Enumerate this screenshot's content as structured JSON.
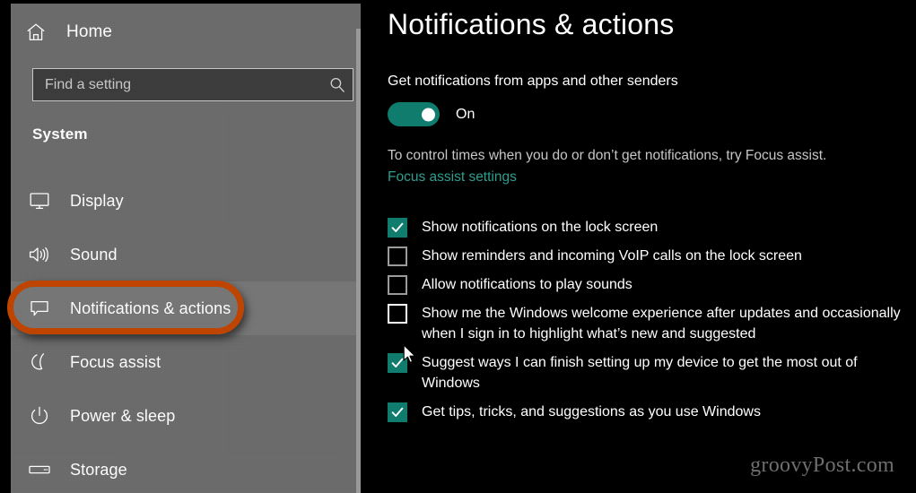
{
  "colors": {
    "sidebar_bg": "#6a6a6a",
    "sidebar_selected_bg": "#757575",
    "main_bg": "#000000",
    "accent_teal": "#107c6d",
    "link_teal": "#2e9e8f",
    "annotation_orange": "#bf4400",
    "search_bg": "#3b3b3b",
    "search_border": "#c8c8c8",
    "watermark": "#6e6e6e"
  },
  "sidebar": {
    "home": {
      "label": "Home",
      "icon": "home-icon"
    },
    "search": {
      "placeholder": "Find a setting",
      "value": "",
      "icon": "search-icon"
    },
    "section_title": "System",
    "items": [
      {
        "label": "Display",
        "icon": "monitor-icon",
        "selected": false
      },
      {
        "label": "Sound",
        "icon": "speaker-icon",
        "selected": false
      },
      {
        "label": "Notifications & actions",
        "icon": "speech-bubble-icon",
        "selected": true
      },
      {
        "label": "Focus assist",
        "icon": "moon-icon",
        "selected": false
      },
      {
        "label": "Power & sleep",
        "icon": "power-icon",
        "selected": false
      },
      {
        "label": "Storage",
        "icon": "drive-icon",
        "selected": false
      }
    ]
  },
  "main": {
    "title": "Notifications & actions",
    "toggle": {
      "caption": "Get notifications from apps and other senders",
      "state_label": "On",
      "on": true
    },
    "focus": {
      "description": "To control times when you do or don’t get notifications, try Focus assist.",
      "link_label": "Focus assist settings"
    },
    "checkboxes": [
      {
        "label": "Show notifications on the lock screen",
        "checked": true,
        "hovered": false
      },
      {
        "label": "Show reminders and incoming VoIP calls on the lock screen",
        "checked": false,
        "hovered": false
      },
      {
        "label": "Allow notifications to play sounds",
        "checked": false,
        "hovered": false
      },
      {
        "label": "Show me the Windows welcome experience after updates and occasionally when I sign in to highlight what’s new and suggested",
        "checked": false,
        "hovered": true
      },
      {
        "label": "Suggest ways I can finish setting up my device to get the most out of Windows",
        "checked": true,
        "hovered": false
      },
      {
        "label": "Get tips, tricks, and suggestions as you use Windows",
        "checked": true,
        "hovered": false
      }
    ]
  },
  "watermark": {
    "text": "groovyPost.com"
  }
}
